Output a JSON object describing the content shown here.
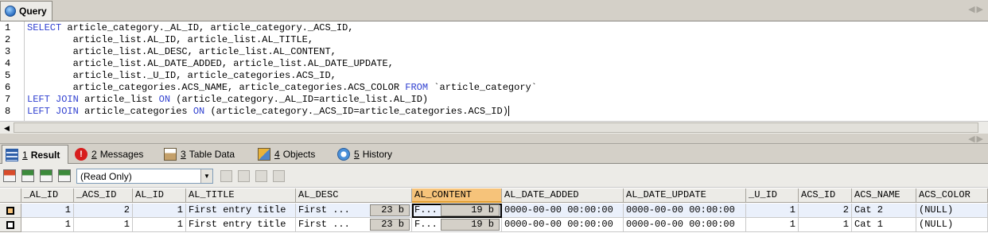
{
  "query_tab": {
    "label": "Query"
  },
  "editor": {
    "lines": [
      {
        "num": "1",
        "kw": "SELECT",
        "text": " article_category._AL_ID, article_category._ACS_ID,"
      },
      {
        "num": "2",
        "kw": "",
        "text": "        article_list.AL_ID, article_list.AL_TITLE,"
      },
      {
        "num": "3",
        "kw": "",
        "text": "        article_list.AL_DESC, article_list.AL_CONTENT,"
      },
      {
        "num": "4",
        "kw": "",
        "text": "        article_list.AL_DATE_ADDED, article_list.AL_DATE_UPDATE,"
      },
      {
        "num": "5",
        "kw": "",
        "text": "        article_list._U_ID, article_categories.ACS_ID,"
      },
      {
        "num": "6",
        "kw": "",
        "text": "        article_categories.ACS_NAME, article_categories.ACS_COLOR ",
        "kw2": "FROM",
        "text2": " `article_category`"
      },
      {
        "num": "7",
        "kw": "LEFT JOIN",
        "text": " article_list ",
        "kw2": "ON",
        "text2": " (article_category._AL_ID=article_list.AL_ID)"
      },
      {
        "num": "8",
        "kw": "LEFT JOIN",
        "text": " article_categories ",
        "kw2": "ON",
        "text2": " (article_category._ACS_ID=article_categories.ACS_ID)"
      }
    ]
  },
  "result_tabs": [
    {
      "num": "1",
      "label": "Result",
      "active": true,
      "icon": "result-grid-icon"
    },
    {
      "num": "2",
      "label": "Messages",
      "active": false,
      "icon": "messages-icon"
    },
    {
      "num": "3",
      "label": "Table Data",
      "active": false,
      "icon": "table-data-icon"
    },
    {
      "num": "4",
      "label": "Objects",
      "active": false,
      "icon": "objects-icon"
    },
    {
      "num": "5",
      "label": "History",
      "active": false,
      "icon": "history-icon"
    }
  ],
  "toolbar": {
    "mode_value": "(Read Only)"
  },
  "grid": {
    "columns": [
      "_AL_ID",
      "_ACS_ID",
      "AL_ID",
      "AL_TITLE",
      "AL_DESC",
      "AL_CONTENT",
      "AL_DATE_ADDED",
      "AL_DATE_UPDATE",
      "_U_ID",
      "ACS_ID",
      "ACS_NAME",
      "ACS_COLOR"
    ],
    "selected_column": "AL_CONTENT",
    "rows": [
      {
        "al_id_fk": "1",
        "acs_id_fk": "2",
        "al_id": "1",
        "title": "First entry title",
        "desc": "First ...",
        "desc_size": "23 b",
        "content": "F...",
        "content_size": "19 b",
        "date_added": "0000-00-00 00:00:00",
        "date_update": "0000-00-00 00:00:00",
        "u_id": "1",
        "acs_id": "2",
        "acs_name": "Cat 2",
        "acs_color": "(NULL)"
      },
      {
        "al_id_fk": "1",
        "acs_id_fk": "1",
        "al_id": "1",
        "title": "First entry title",
        "desc": "First ...",
        "desc_size": "23 b",
        "content": "F...",
        "content_size": "19 b",
        "date_added": "0000-00-00 00:00:00",
        "date_update": "0000-00-00 00:00:00",
        "u_id": "1",
        "acs_id": "1",
        "acs_name": "Cat 1",
        "acs_color": "(NULL)"
      }
    ]
  }
}
